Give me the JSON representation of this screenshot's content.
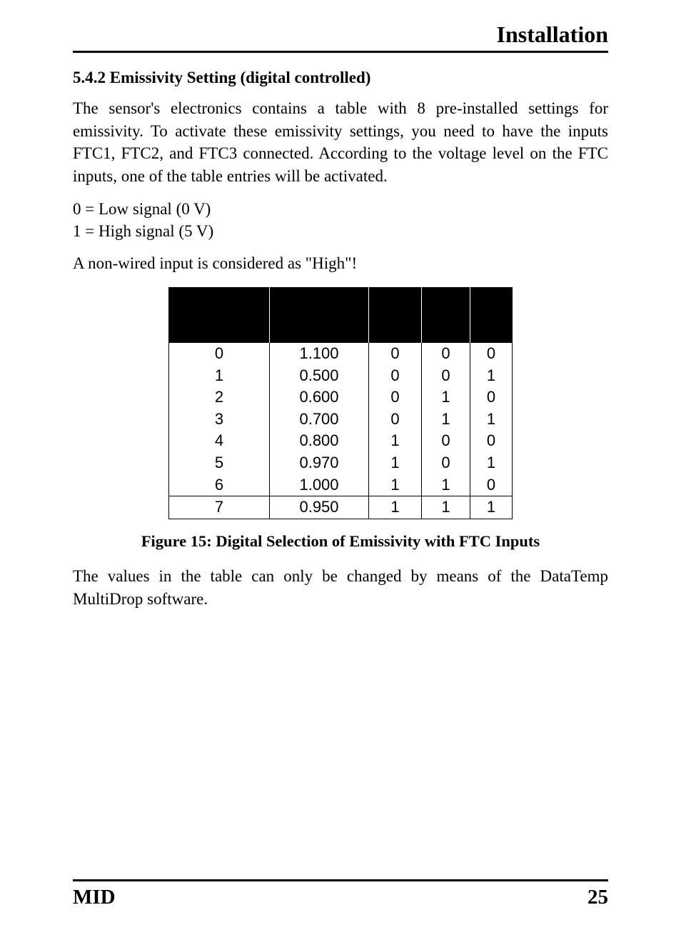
{
  "header": {
    "title": "Installation"
  },
  "section": {
    "number_title": "5.4.2 Emissivity Setting (digital controlled)",
    "para1": "The sensor's electronics contains a table with 8 pre-installed settings for emissivity. To activate these emissivity settings, you need to have the inputs FTC1, FTC2, and FTC3 connected. According to the voltage level on the FTC inputs, one of the table entries will be activated.",
    "legend_low": "0 = Low signal (0 V)",
    "legend_high": "1 = High signal (5 V)",
    "note": "A non-wired input is considered as \"High\"!",
    "para2": "The values in the table can only be changed by means of the DataTemp MultiDrop software."
  },
  "table": {
    "headers": {
      "entry": "",
      "emis": "",
      "ftc1": "",
      "ftc2": "",
      "ftc3": ""
    },
    "rows": [
      {
        "entry": "0",
        "emis": "1.100",
        "ftc1": "0",
        "ftc2": "0",
        "ftc3": "0"
      },
      {
        "entry": "1",
        "emis": "0.500",
        "ftc1": "0",
        "ftc2": "0",
        "ftc3": "1"
      },
      {
        "entry": "2",
        "emis": "0.600",
        "ftc1": "0",
        "ftc2": "1",
        "ftc3": "0"
      },
      {
        "entry": "3",
        "emis": "0.700",
        "ftc1": "0",
        "ftc2": "1",
        "ftc3": "1"
      },
      {
        "entry": "4",
        "emis": "0.800",
        "ftc1": "1",
        "ftc2": "0",
        "ftc3": "0"
      },
      {
        "entry": "5",
        "emis": "0.970",
        "ftc1": "1",
        "ftc2": "0",
        "ftc3": "1"
      },
      {
        "entry": "6",
        "emis": "1.000",
        "ftc1": "1",
        "ftc2": "1",
        "ftc3": "0"
      },
      {
        "entry": "7",
        "emis": "0.950",
        "ftc1": "1",
        "ftc2": "1",
        "ftc3": "1"
      }
    ]
  },
  "caption": "Figure 15: Digital Selection of Emissivity with FTC Inputs",
  "footer": {
    "left": "MID",
    "right": "25"
  }
}
